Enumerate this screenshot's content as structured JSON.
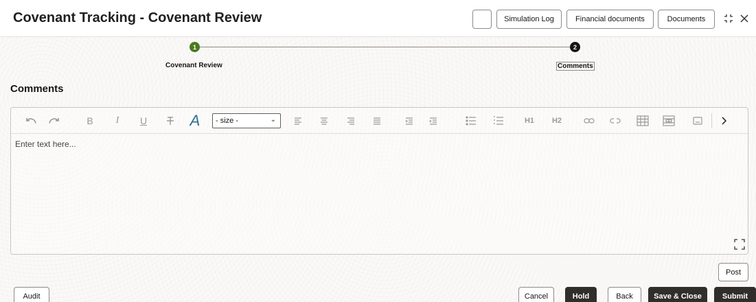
{
  "header": {
    "title": "Covenant Tracking - Covenant Review",
    "buttons": {
      "simulation_log": "Simulation Log",
      "financial_documents": "Financial documents",
      "documents": "Documents"
    }
  },
  "train": {
    "steps": [
      {
        "number": "1",
        "label": "Covenant Review",
        "status": "completed",
        "color": "#4a7a1f"
      },
      {
        "number": "2",
        "label": "Comments",
        "status": "current",
        "color": "#161513"
      }
    ]
  },
  "section": {
    "title": "Comments"
  },
  "editor": {
    "size_select": {
      "value": "- size -"
    },
    "placeholder": "Enter text here...",
    "toolbar_icons": [
      "undo-icon",
      "redo-icon",
      "bold-icon",
      "italic-icon",
      "underline-icon",
      "strikethrough-icon",
      "font-color-icon",
      "align-left-icon",
      "align-center-icon",
      "align-right-icon",
      "align-justify-icon",
      "indent-icon",
      "outdent-icon",
      "bullet-list-icon",
      "numbered-list-icon",
      "heading-1-icon",
      "heading-2-icon",
      "link-icon",
      "unlink-icon",
      "table-icon",
      "table-props-icon",
      "image-icon",
      "more-chevron-icon"
    ],
    "heading1": "H1",
    "heading2": "H2",
    "bold": "B",
    "italic": "I",
    "underline": "U",
    "font_color": "A"
  },
  "actions": {
    "post": "Post",
    "audit": "Audit",
    "cancel": "Cancel",
    "hold": "Hold",
    "back": "Back",
    "save_close": "Save & Close",
    "submit": "Submit"
  }
}
